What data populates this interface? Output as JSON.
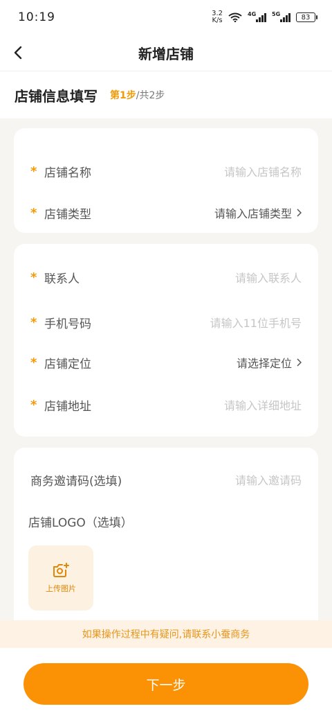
{
  "status_bar": {
    "time": "10:19",
    "net_speed_value": "3.2",
    "net_speed_unit": "K/s",
    "signal_1_label": "4G",
    "signal_2_label": "5G",
    "battery": "83"
  },
  "nav": {
    "title": "新增店铺"
  },
  "step": {
    "title": "店铺信息填写",
    "current": "第1步",
    "total": "/共2步"
  },
  "card1": {
    "rows": [
      {
        "label": "店铺名称",
        "value": "请输入店铺名称",
        "required": "*"
      },
      {
        "label": "店铺类型",
        "value": "请输入店铺类型",
        "required": "*"
      }
    ]
  },
  "card2": {
    "rows": [
      {
        "label": "联系人",
        "value": "请输入联系人",
        "required": "*"
      },
      {
        "label": "手机号码",
        "value": "请输入11位手机号",
        "required": "*"
      },
      {
        "label": "店铺定位",
        "value": "请选择定位",
        "required": "*"
      },
      {
        "label": "店铺地址",
        "value": "请输入详细地址",
        "required": "*"
      }
    ]
  },
  "card3": {
    "invite_label": "商务邀请码(选填)",
    "invite_placeholder": "请输入邀请码",
    "logo_label": "店铺LOGO（选填）",
    "upload_text": "上传图片"
  },
  "tip": "如果操作过程中有疑问,请联系小蚕商务",
  "next_button": "下一步",
  "colors": {
    "accent": "#fb9206",
    "required": "#f29a06",
    "background": "#f6f5f2"
  }
}
